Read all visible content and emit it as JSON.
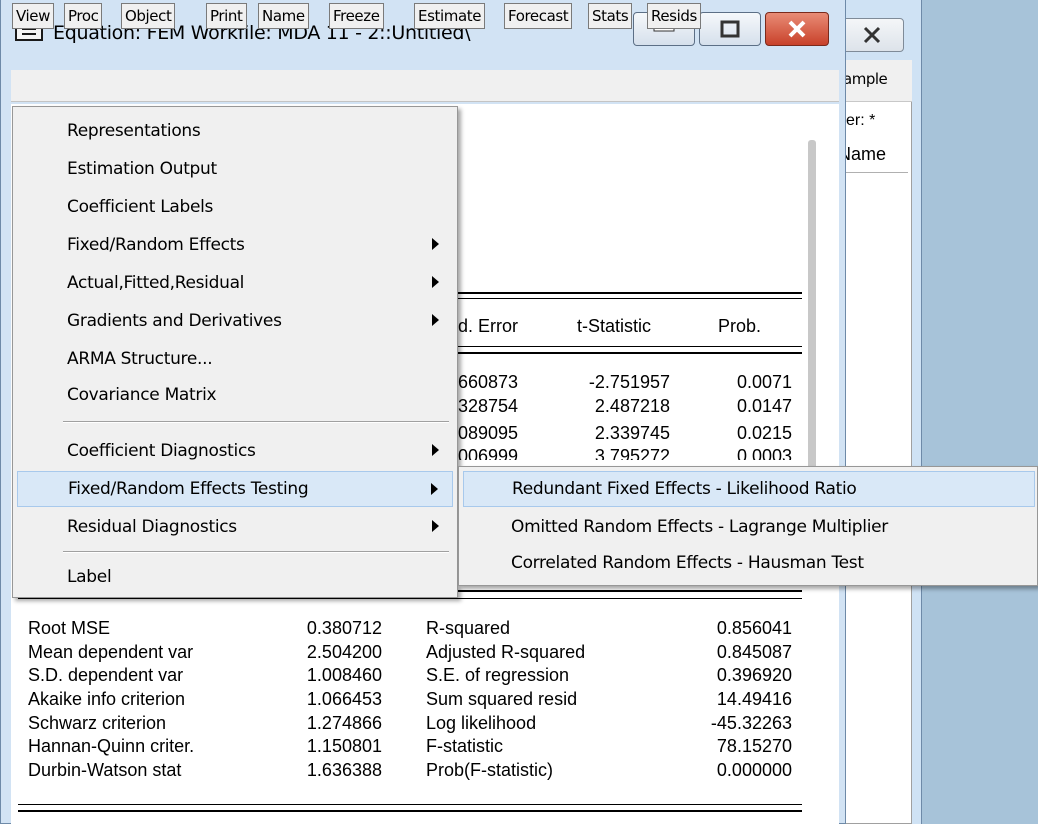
{
  "bg_window": {
    "sample_label": "Sample",
    "filter_label": "lter: *",
    "name_header": "Name"
  },
  "window": {
    "title": "Equation: FEM   Workfile: MDA 11 - 2::Untitled\\"
  },
  "toolbar": {
    "view": "View",
    "proc": "Proc",
    "object": "Object",
    "print": "Print",
    "name": "Name",
    "freeze": "Freeze",
    "estimate": "Estimate",
    "forecast": "Forecast",
    "stats": "Stats",
    "resids": "Resids"
  },
  "view_menu": {
    "items": [
      {
        "label": "Representations"
      },
      {
        "label": "Estimation Output"
      },
      {
        "label": "Coefficient Labels"
      },
      {
        "label": "Fixed/Random Effects"
      },
      {
        "label": "Actual,Fitted,Residual"
      },
      {
        "label": "Gradients and Derivatives"
      },
      {
        "label": "ARMA Structure..."
      },
      {
        "label": "Covariance Matrix"
      },
      {
        "label": "Coefficient Diagnostics"
      },
      {
        "label": "Fixed/Random Effects Testing"
      },
      {
        "label": "Residual Diagnostics"
      },
      {
        "label": "Label"
      }
    ],
    "highlighted": "Fixed/Random Effects Testing"
  },
  "submenu": {
    "items": [
      {
        "label": "Redundant Fixed Effects - Likelihood Ratio"
      },
      {
        "label": "Omitted Random Effects - Lagrange Multiplier"
      },
      {
        "label": "Correlated Random Effects - Hausman Test"
      }
    ],
    "highlighted": "Redundant Fixed Effects - Likelihood Ratio"
  },
  "coef_table": {
    "headers": {
      "se": "d. Error",
      "t": "t-Statistic",
      "prob": "Prob."
    },
    "rows": [
      {
        "se": "660873",
        "t": "-2.751957",
        "prob": "0.0071"
      },
      {
        "se": "328754",
        "t": "2.487218",
        "prob": "0.0147"
      },
      {
        "se": "089095",
        "t": "2.339745",
        "prob": "0.0215"
      },
      {
        "se": "006999",
        "t": "3.795272",
        "prob": "0.0003"
      }
    ]
  },
  "stats_table": {
    "left": [
      {
        "label": "Root MSE",
        "value": "0.380712"
      },
      {
        "label": "Mean dependent var",
        "value": "2.504200"
      },
      {
        "label": "S.D. dependent var",
        "value": "1.008460"
      },
      {
        "label": "Akaike info criterion",
        "value": "1.066453"
      },
      {
        "label": "Schwarz criterion",
        "value": "1.274866"
      },
      {
        "label": "Hannan-Quinn criter.",
        "value": "1.150801"
      },
      {
        "label": "Durbin-Watson stat",
        "value": "1.636388"
      }
    ],
    "right": [
      {
        "label": "R-squared",
        "value": "0.856041"
      },
      {
        "label": "Adjusted R-squared",
        "value": "0.845087"
      },
      {
        "label": "S.E. of regression",
        "value": "0.396920"
      },
      {
        "label": "Sum squared resid",
        "value": "14.49416"
      },
      {
        "label": "Log likelihood",
        "value": "-45.32263"
      },
      {
        "label": "F-statistic",
        "value": "78.15270"
      },
      {
        "label": "Prob(F-statistic)",
        "value": "0.000000"
      }
    ]
  }
}
